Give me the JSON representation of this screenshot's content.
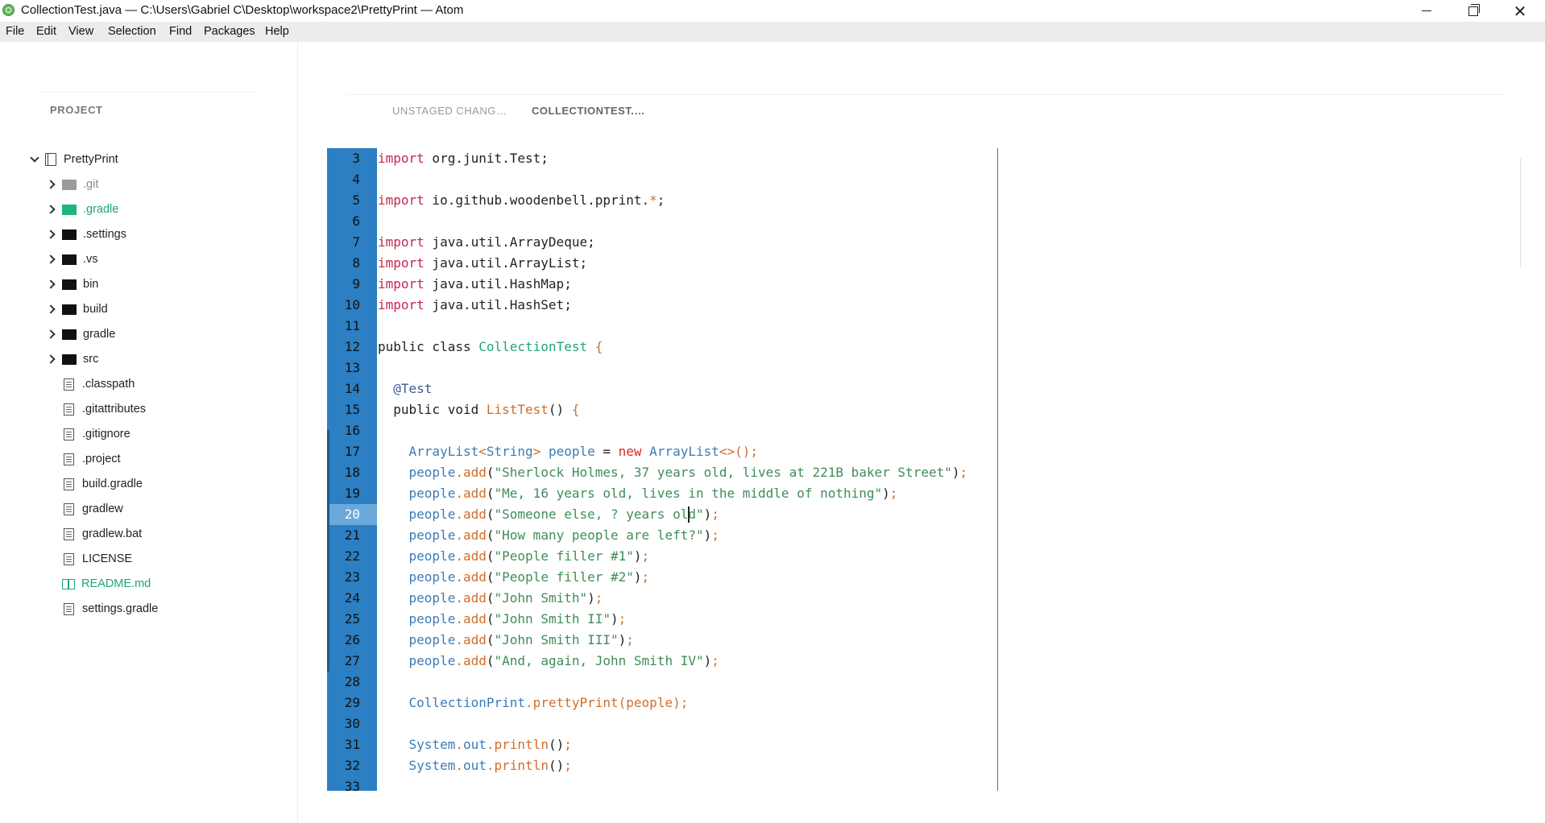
{
  "window": {
    "title": "CollectionTest.java — C:\\Users\\Gabriel C\\Desktop\\workspace2\\PrettyPrint — Atom",
    "minimize_glyph": "",
    "close_glyph": "✕"
  },
  "menu": [
    "File",
    "Edit",
    "View",
    "Selection",
    "Find",
    "Packages",
    "Help"
  ],
  "sidebar": {
    "title": "PROJECT",
    "root": "PrettyPrint",
    "items": [
      {
        "label": ".git",
        "kind": "folder",
        "color": "#9a9a9a",
        "text_color": "#8a8a8a"
      },
      {
        "label": ".gradle",
        "kind": "folder",
        "color": "#1fb47c",
        "text_color": "#1fa579"
      },
      {
        "label": ".settings",
        "kind": "folder",
        "color": "#111111",
        "text_color": "#222222"
      },
      {
        "label": ".vs",
        "kind": "folder",
        "color": "#111111",
        "text_color": "#222222"
      },
      {
        "label": "bin",
        "kind": "folder",
        "color": "#111111",
        "text_color": "#222222"
      },
      {
        "label": "build",
        "kind": "folder",
        "color": "#111111",
        "text_color": "#222222"
      },
      {
        "label": "gradle",
        "kind": "folder",
        "color": "#111111",
        "text_color": "#222222"
      },
      {
        "label": "src",
        "kind": "folder",
        "color": "#111111",
        "text_color": "#222222"
      },
      {
        "label": ".classpath",
        "kind": "file",
        "text_color": "#222222"
      },
      {
        "label": ".gitattributes",
        "kind": "file",
        "text_color": "#222222"
      },
      {
        "label": ".gitignore",
        "kind": "file",
        "text_color": "#222222"
      },
      {
        "label": ".project",
        "kind": "file",
        "text_color": "#222222"
      },
      {
        "label": "build.gradle",
        "kind": "file",
        "text_color": "#222222"
      },
      {
        "label": "gradlew",
        "kind": "file",
        "text_color": "#222222"
      },
      {
        "label": "gradlew.bat",
        "kind": "file",
        "text_color": "#222222"
      },
      {
        "label": "LICENSE",
        "kind": "file",
        "text_color": "#222222"
      },
      {
        "label": "README.md",
        "kind": "book",
        "text_color": "#1fa579"
      },
      {
        "label": "settings.gradle",
        "kind": "file",
        "text_color": "#222222"
      }
    ]
  },
  "tabs": [
    {
      "label": "UNSTAGED CHANG…",
      "active": false
    },
    {
      "label": "COLLECTIONTEST.…",
      "active": true
    }
  ],
  "editor": {
    "current_line": 20,
    "cursor_line": 20,
    "cursor_col": 40,
    "lines": [
      {
        "n": 3,
        "seg": [
          [
            "k",
            "import"
          ],
          [
            "pl",
            " org.junit.Test;"
          ]
        ]
      },
      {
        "n": 4,
        "seg": []
      },
      {
        "n": 5,
        "seg": [
          [
            "k",
            "import"
          ],
          [
            "pl",
            " io.github.woodenbell.pprint."
          ],
          [
            "pun",
            "*"
          ],
          [
            "pl",
            ";"
          ]
        ]
      },
      {
        "n": 6,
        "seg": []
      },
      {
        "n": 7,
        "seg": [
          [
            "k",
            "import"
          ],
          [
            "pl",
            " java.util.ArrayDeque;"
          ]
        ]
      },
      {
        "n": 8,
        "seg": [
          [
            "k",
            "import"
          ],
          [
            "pl",
            " java.util.ArrayList;"
          ]
        ]
      },
      {
        "n": 9,
        "seg": [
          [
            "k",
            "import"
          ],
          [
            "pl",
            " java.util.HashMap;"
          ]
        ]
      },
      {
        "n": 10,
        "seg": [
          [
            "k",
            "import"
          ],
          [
            "pl",
            " java.util.HashSet;"
          ]
        ]
      },
      {
        "n": 11,
        "seg": []
      },
      {
        "n": 12,
        "seg": [
          [
            "pl",
            "public class "
          ],
          [
            "cls",
            "CollectionTest"
          ],
          [
            "pun",
            " {"
          ]
        ]
      },
      {
        "n": 13,
        "seg": []
      },
      {
        "n": 14,
        "seg": [
          [
            "an",
            "  @Test"
          ]
        ]
      },
      {
        "n": 15,
        "seg": [
          [
            "pl",
            "  public void "
          ],
          [
            "fn",
            "ListTest"
          ],
          [
            "pl",
            "() "
          ],
          [
            "pun",
            "{"
          ]
        ]
      },
      {
        "n": 16,
        "seg": []
      },
      {
        "n": 17,
        "seg": [
          [
            "ty",
            "    ArrayList"
          ],
          [
            "pun",
            "<"
          ],
          [
            "ty",
            "String"
          ],
          [
            "pun",
            "> "
          ],
          [
            "var",
            "people"
          ],
          [
            "pl",
            " = "
          ],
          [
            "nw",
            "new"
          ],
          [
            "ty",
            " ArrayList"
          ],
          [
            "pun",
            "<>();"
          ]
        ]
      },
      {
        "n": 18,
        "seg": [
          [
            "var",
            "    people"
          ],
          [
            "pun",
            "."
          ],
          [
            "fn",
            "add"
          ],
          [
            "pl",
            "("
          ],
          [
            "str",
            "\"Sherlock Holmes, 37 years old, lives at 221B baker Street\""
          ],
          [
            "pl",
            ")"
          ],
          [
            "pun",
            ";"
          ]
        ]
      },
      {
        "n": 19,
        "seg": [
          [
            "var",
            "    people"
          ],
          [
            "pun",
            "."
          ],
          [
            "fn",
            "add"
          ],
          [
            "pl",
            "("
          ],
          [
            "str",
            "\"Me, 16 years old, lives in the middle of nothing\""
          ],
          [
            "pl",
            ")"
          ],
          [
            "pun",
            ";"
          ]
        ]
      },
      {
        "n": 20,
        "seg": [
          [
            "var",
            "    people"
          ],
          [
            "pun",
            "."
          ],
          [
            "fn",
            "add"
          ],
          [
            "pl",
            "("
          ],
          [
            "str",
            "\"Someone else, ? years old\""
          ],
          [
            "pl",
            ")"
          ],
          [
            "pun",
            ";"
          ]
        ]
      },
      {
        "n": 21,
        "seg": [
          [
            "var",
            "    people"
          ],
          [
            "pun",
            "."
          ],
          [
            "fn",
            "add"
          ],
          [
            "pl",
            "("
          ],
          [
            "str",
            "\"How many people are left?\""
          ],
          [
            "pl",
            ")"
          ],
          [
            "pun",
            ";"
          ]
        ]
      },
      {
        "n": 22,
        "seg": [
          [
            "var",
            "    people"
          ],
          [
            "pun",
            "."
          ],
          [
            "fn",
            "add"
          ],
          [
            "pl",
            "("
          ],
          [
            "str",
            "\"People filler #1\""
          ],
          [
            "pl",
            ")"
          ],
          [
            "pun",
            ";"
          ]
        ]
      },
      {
        "n": 23,
        "seg": [
          [
            "var",
            "    people"
          ],
          [
            "pun",
            "."
          ],
          [
            "fn",
            "add"
          ],
          [
            "pl",
            "("
          ],
          [
            "str",
            "\"People filler #2\""
          ],
          [
            "pl",
            ")"
          ],
          [
            "pun",
            ";"
          ]
        ]
      },
      {
        "n": 24,
        "seg": [
          [
            "var",
            "    people"
          ],
          [
            "pun",
            "."
          ],
          [
            "fn",
            "add"
          ],
          [
            "pl",
            "("
          ],
          [
            "str",
            "\"John Smith\""
          ],
          [
            "pl",
            ")"
          ],
          [
            "pun",
            ";"
          ]
        ]
      },
      {
        "n": 25,
        "seg": [
          [
            "var",
            "    people"
          ],
          [
            "pun",
            "."
          ],
          [
            "fn",
            "add"
          ],
          [
            "pl",
            "("
          ],
          [
            "str",
            "\"John Smith II\""
          ],
          [
            "pl",
            ")"
          ],
          [
            "pun",
            ";"
          ]
        ]
      },
      {
        "n": 26,
        "seg": [
          [
            "var",
            "    people"
          ],
          [
            "pun",
            "."
          ],
          [
            "fn",
            "add"
          ],
          [
            "pl",
            "("
          ],
          [
            "str",
            "\"John Smith III\""
          ],
          [
            "pl",
            ")"
          ],
          [
            "pun",
            ";"
          ]
        ]
      },
      {
        "n": 27,
        "seg": [
          [
            "var",
            "    people"
          ],
          [
            "pun",
            "."
          ],
          [
            "fn",
            "add"
          ],
          [
            "pl",
            "("
          ],
          [
            "str",
            "\"And, again, John Smith IV\""
          ],
          [
            "pl",
            ")"
          ],
          [
            "pun",
            ";"
          ]
        ]
      },
      {
        "n": 28,
        "seg": []
      },
      {
        "n": 29,
        "seg": [
          [
            "ty",
            "    CollectionPrint"
          ],
          [
            "pun",
            "."
          ],
          [
            "fn",
            "prettyPrint"
          ],
          [
            "pun",
            "("
          ],
          [
            "fn",
            "people"
          ],
          [
            "pun",
            ");"
          ]
        ]
      },
      {
        "n": 30,
        "seg": []
      },
      {
        "n": 31,
        "seg": [
          [
            "ty",
            "    System"
          ],
          [
            "pun",
            "."
          ],
          [
            "var",
            "out"
          ],
          [
            "pun",
            "."
          ],
          [
            "fn",
            "println"
          ],
          [
            "pl",
            "()"
          ],
          [
            "pun",
            ";"
          ]
        ]
      },
      {
        "n": 32,
        "seg": [
          [
            "ty",
            "    System"
          ],
          [
            "pun",
            "."
          ],
          [
            "var",
            "out"
          ],
          [
            "pun",
            "."
          ],
          [
            "fn",
            "println"
          ],
          [
            "pl",
            "()"
          ],
          [
            "pun",
            ";"
          ]
        ]
      },
      {
        "n": 33,
        "seg": []
      }
    ]
  }
}
